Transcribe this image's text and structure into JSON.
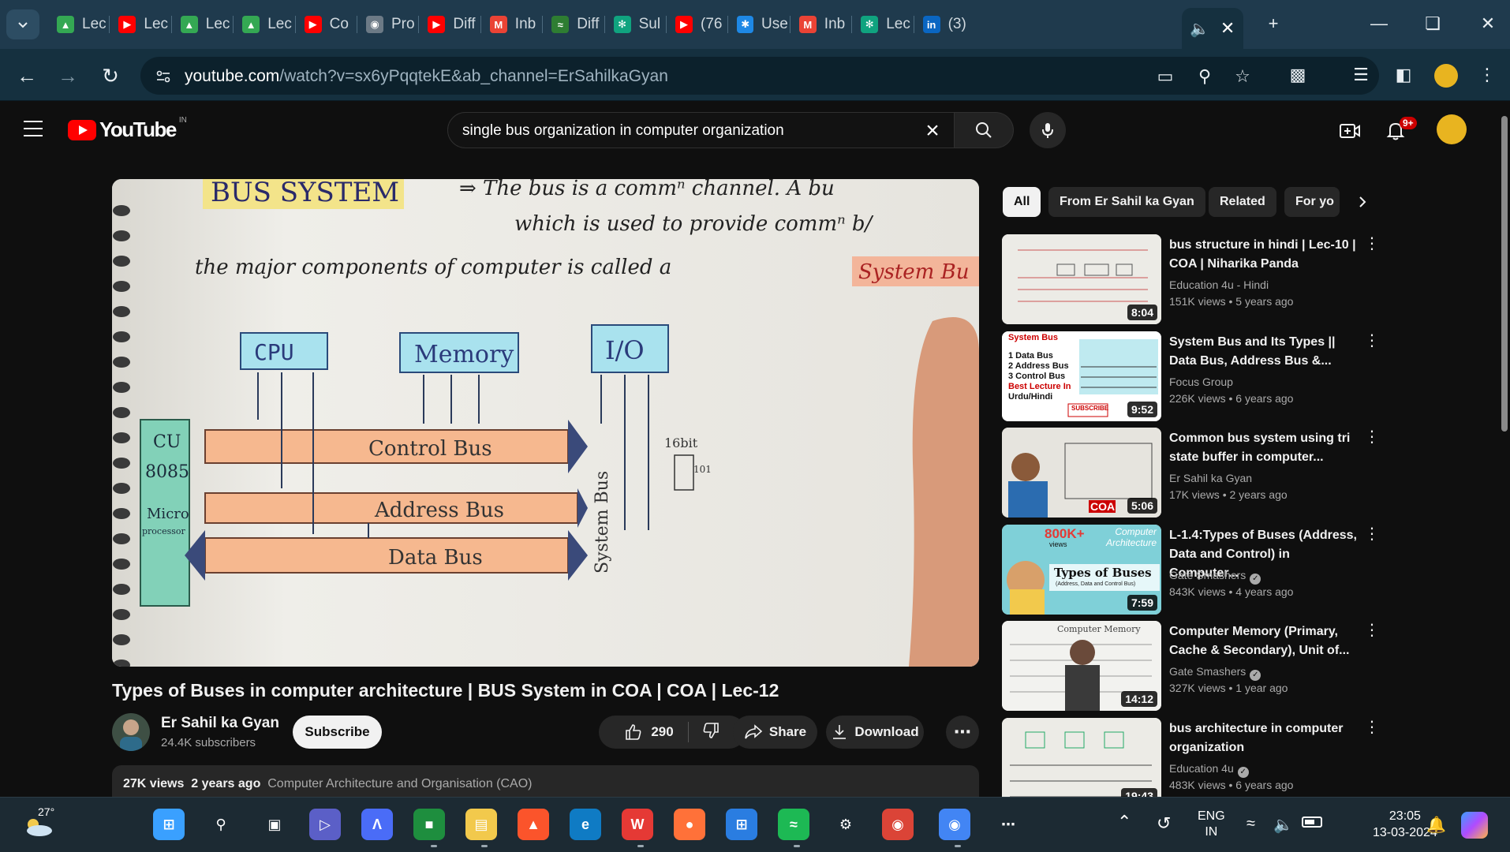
{
  "browser": {
    "tabs": [
      {
        "label": "Lec",
        "icon": "google-drive-icon",
        "color": "#34a853"
      },
      {
        "label": "Lec",
        "icon": "youtube-icon",
        "color": "#ff0000"
      },
      {
        "label": "Lec",
        "icon": "google-drive-icon",
        "color": "#34a853"
      },
      {
        "label": "Lec",
        "icon": "google-drive-icon",
        "color": "#34a853"
      },
      {
        "label": "Co",
        "icon": "youtube-icon",
        "color": "#ff0000"
      },
      {
        "label": "Pro",
        "icon": "globe-icon",
        "color": "#6c7a86"
      },
      {
        "label": "Diff",
        "icon": "youtube-icon",
        "color": "#ff0000"
      },
      {
        "label": "Inb",
        "icon": "gmail-icon",
        "color": "#ea4335"
      },
      {
        "label": "Diff",
        "icon": "diff-icon",
        "color": "#2e7d32"
      },
      {
        "label": "Sul",
        "icon": "chatgpt-icon",
        "color": "#10a37f"
      },
      {
        "label": "(76",
        "icon": "youtube-icon",
        "color": "#ff0000"
      },
      {
        "label": "Use",
        "icon": "perplexity-icon",
        "color": "#1e88e5"
      },
      {
        "label": "Inb",
        "icon": "gmail-icon",
        "color": "#ea4335"
      },
      {
        "label": "Lec",
        "icon": "chatgpt-icon",
        "color": "#10a37f"
      },
      {
        "label": "(3)",
        "icon": "linkedin-icon",
        "color": "#0a66c2"
      }
    ],
    "url_host": "youtube.com",
    "url_path": "/watch?v=sx6yPqqtekE&ab_channel=ErSahilkaGyan"
  },
  "youtube": {
    "logo": "YouTube",
    "country_code": "IN",
    "search_query": "single bus organization in computer organization",
    "notification_count": "9+"
  },
  "video": {
    "title": "Types of Buses in computer architecture | BUS System in COA | COA | Lec-12",
    "channel": "Er Sahil ka Gyan",
    "subscribers": "24.4K subscribers",
    "subscribe_label": "Subscribe",
    "likes": "290",
    "share_label": "Share",
    "download_label": "Download",
    "views": "27K views",
    "age": "2 years ago",
    "playlist": "Computer Architecture and Organisation (CAO)",
    "frame": {
      "line1_a": "BUS SYSTEM",
      "line1_b": "⇒ The bus is a commⁿ channel. A bu",
      "line2": "which is used to provide commⁿ b/",
      "line3": "the major components of computer is called a",
      "line3_highlight": "System Bu",
      "cpu": "CPU",
      "memory": "Memory",
      "io": "I/O",
      "cu": "CU",
      "chip": "8085",
      "micro": "Micro",
      "processor": "processor",
      "control_bus": "Control Bus",
      "address_bus": "Address Bus",
      "data_bus": "Data Bus",
      "system_bus": "System Bus",
      "bits": "16bit",
      "io_bits": "101"
    }
  },
  "sidebar": {
    "chips": [
      "All",
      "From Er Sahil ka Gyan",
      "Related",
      "For yo"
    ],
    "recommendations": [
      {
        "title": "bus structure in hindi | Lec-10 | COA | Niharika Panda",
        "channel": "Education 4u - Hindi",
        "verified": false,
        "views": "151K views",
        "age": "5 years ago",
        "duration": "8:04",
        "thumb": "whiteboard"
      },
      {
        "title": "System Bus and Its Types || Data Bus, Address Bus &...",
        "channel": "Focus Group",
        "verified": false,
        "views": "226K views",
        "age": "6 years ago",
        "duration": "9:52",
        "thumb": "focus"
      },
      {
        "title": "Common bus system using tri state buffer in computer...",
        "channel": "Er Sahil ka Gyan",
        "verified": false,
        "views": "17K views",
        "age": "2 years ago",
        "duration": "5:06",
        "thumb": "sahil"
      },
      {
        "title": "L-1.4:Types of Buses (Address, Data and Control) in Computer...",
        "channel": "Gate Smashers",
        "verified": true,
        "views": "843K views",
        "age": "4 years ago",
        "duration": "7:59",
        "thumb": "gate"
      },
      {
        "title": "Computer Memory (Primary, Cache & Secondary), Unit of...",
        "channel": "Gate Smashers",
        "verified": true,
        "views": "327K views",
        "age": "1 year ago",
        "duration": "14:12",
        "thumb": "memory"
      },
      {
        "title": "bus architecture in computer organization",
        "channel": "Education 4u",
        "verified": true,
        "views": "483K views",
        "age": "6 years ago",
        "duration": "19:43",
        "thumb": "whiteboard2"
      }
    ],
    "thumb_text": {
      "focus_title": "System Bus",
      "focus_items": [
        "1 Data Bus",
        "2 Address Bus",
        "3 Control Bus"
      ],
      "focus_best": "Best Lecture In",
      "focus_lang": "Urdu/Hindi",
      "focus_sub": "SUBSCRIBE",
      "coa": "COA",
      "gate_views": "800K+",
      "gate_views_sub": "views",
      "gate_arch1": "Computer",
      "gate_arch2": "Architecture",
      "gate_title": "Types of Buses",
      "gate_sub": "(Address, Data and Control Bus)",
      "memory_title": "Computer Memory"
    }
  },
  "taskbar": {
    "temperature": "27°",
    "language": "ENG",
    "region": "IN",
    "time": "23:05",
    "date": "13-03-2024"
  }
}
